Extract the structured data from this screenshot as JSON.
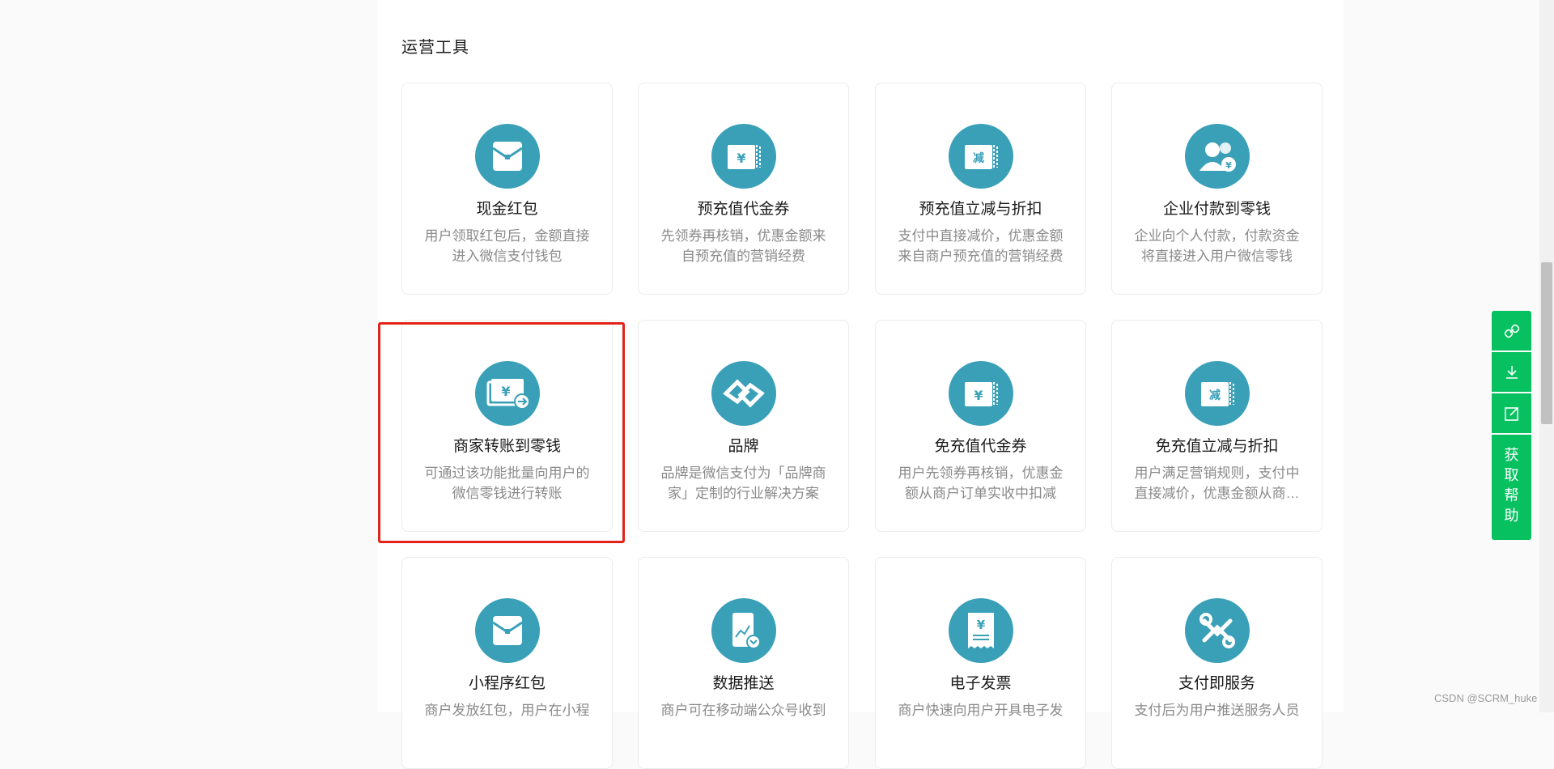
{
  "section": {
    "title": "运营工具"
  },
  "cards": [
    {
      "title": "现金红包",
      "desc1": "用户领取红包后，金额直接",
      "desc2": "进入微信支付钱包",
      "icon": "red-envelope-icon"
    },
    {
      "title": "预充值代金券",
      "desc1": "先领券再核销，优惠金额来",
      "desc2": "自预充值的营销经费",
      "icon": "yuan-coupon-icon"
    },
    {
      "title": "预充值立减与折扣",
      "desc1": "支付中直接减价，优惠金额",
      "desc2": "来自商户预充值的营销经费",
      "icon": "discount-coupon-icon"
    },
    {
      "title": "企业付款到零钱",
      "desc1": "企业向个人付款，付款资金",
      "desc2": "将直接进入用户微信零钱",
      "icon": "enterprise-payment-icon"
    },
    {
      "title": "商家转账到零钱",
      "desc1": "可通过该功能批量向用户的",
      "desc2": "微信零钱进行转账",
      "icon": "merchant-transfer-icon"
    },
    {
      "title": "品牌",
      "desc1": "品牌是微信支付为「品牌商",
      "desc2": "家」定制的行业解决方案",
      "icon": "brand-link-icon"
    },
    {
      "title": "免充值代金券",
      "desc1": "用户先领券再核销，优惠金",
      "desc2": "额从商户订单实收中扣减",
      "icon": "yuan-coupon-icon"
    },
    {
      "title": "免充值立减与折扣",
      "desc1": "用户满足营销规则，支付中",
      "desc2": "直接减价，优惠金额从商…",
      "icon": "discount-coupon-icon"
    },
    {
      "title": "小程序红包",
      "desc1": "商户发放红包，用户在小程",
      "desc2": "",
      "icon": "red-envelope-icon"
    },
    {
      "title": "数据推送",
      "desc1": "商户可在移动端公众号收到",
      "desc2": "",
      "icon": "data-push-icon"
    },
    {
      "title": "电子发票",
      "desc1": "商户快速向用户开具电子发",
      "desc2": "",
      "icon": "e-invoice-icon"
    },
    {
      "title": "支付即服务",
      "desc1": "支付后为用户推送服务人员",
      "desc2": "",
      "icon": "pay-service-icon"
    }
  ],
  "side_tools": {
    "items": [
      {
        "icon": "link-icon"
      },
      {
        "icon": "download-icon"
      },
      {
        "icon": "edit-icon"
      }
    ],
    "help_label": [
      "获",
      "取",
      "帮",
      "助"
    ]
  },
  "watermark": "CSDN @SCRM_huke",
  "colors": {
    "icon_bg": "#3aa0b8",
    "accent_green": "#07c160",
    "highlight_red": "#e2231a"
  }
}
